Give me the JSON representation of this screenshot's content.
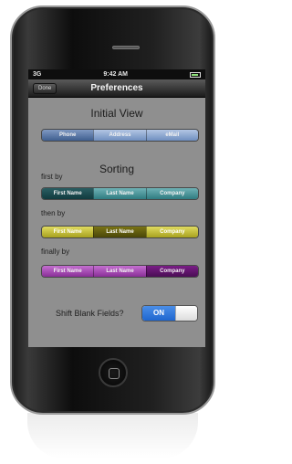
{
  "status": {
    "carrier": "3G",
    "time": "9:42 AM"
  },
  "navbar": {
    "done_label": "Done",
    "title": "Preferences"
  },
  "initial_view": {
    "heading": "Initial View",
    "options": [
      "Phone",
      "Address",
      "eMail"
    ],
    "selected": 0
  },
  "sorting": {
    "heading": "Sorting",
    "first_label": "first by",
    "then_label": "then by",
    "finally_label": "finally by",
    "first_options": [
      "First Name",
      "Last Name",
      "Company"
    ],
    "then_options": [
      "First Name",
      "Last Name",
      "Company"
    ],
    "finally_options": [
      "First Name",
      "Last Name",
      "Company"
    ],
    "first_selected": 0,
    "then_selected": 1,
    "finally_selected": 2
  },
  "shift_blank": {
    "label": "Shift Blank Fields?",
    "state": "ON"
  },
  "colors": {
    "initial": "#6f8fbf",
    "first": "#2f7c81",
    "then": "#a8a21f",
    "finally": "#8a2f98",
    "toggle": "#1f66cf"
  }
}
